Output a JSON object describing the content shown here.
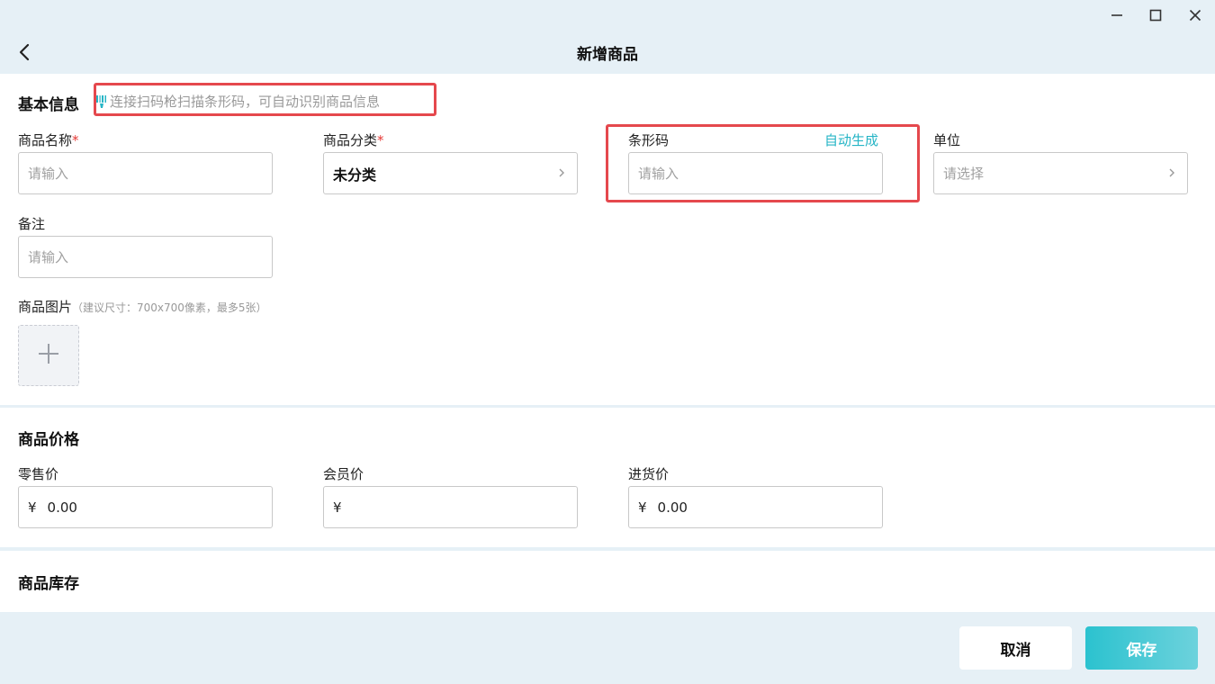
{
  "header": {
    "title": "新增商品"
  },
  "basic": {
    "title": "基本信息",
    "scan_hint": "连接扫码枪扫描条形码，可自动识别商品信息",
    "name": {
      "label": "商品名称",
      "required": "*",
      "placeholder": "请输入"
    },
    "category": {
      "label": "商品分类",
      "required": "*",
      "value": "未分类"
    },
    "barcode": {
      "label": "条形码",
      "auto_label": "自动生成",
      "placeholder": "请输入"
    },
    "unit": {
      "label": "单位",
      "placeholder": "请选择"
    },
    "remark": {
      "label": "备注",
      "placeholder": "请输入"
    },
    "images": {
      "label": "商品图片",
      "hint": "（建议尺寸：700x700像素，最多5张）"
    }
  },
  "price": {
    "title": "商品价格",
    "currency": "¥",
    "retail": {
      "label": "零售价",
      "value": "0.00"
    },
    "member": {
      "label": "会员价",
      "value": ""
    },
    "purchase": {
      "label": "进货价",
      "value": "0.00"
    }
  },
  "stock": {
    "title": "商品库存"
  },
  "footer": {
    "cancel_label": "取消",
    "save_label": "保存"
  },
  "colors": {
    "accent": "#26b5c6",
    "highlight": "#e5484d",
    "required": "#e53935",
    "background": "#e6f0f6"
  }
}
